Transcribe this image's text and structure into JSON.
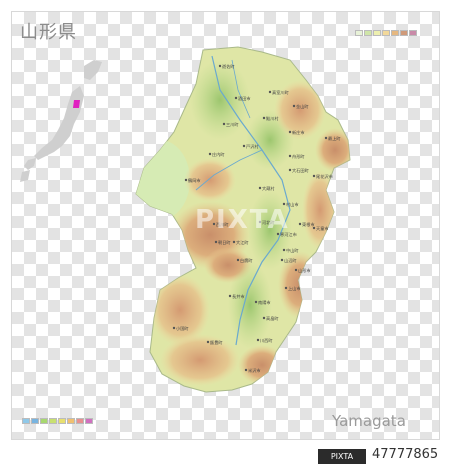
{
  "map": {
    "title_ja": "山形県",
    "title_en": "Yamagata",
    "watermark": "PIXTA",
    "legend_colors_top": [
      "#e8f2d8",
      "#cfe5a8",
      "#eef0b0",
      "#f2d89a",
      "#e6b880",
      "#cf9a7a",
      "#c98aa8"
    ],
    "legend_colors_bottom": [
      "#8fc8e8",
      "#78b4e0",
      "#a8d870",
      "#c8e070",
      "#e8e070",
      "#f0c070",
      "#e89090",
      "#d070c0"
    ],
    "highlight_color": "#e020c0"
  },
  "footer": {
    "logo": "PIXTA",
    "image_id": "47777865"
  },
  "places": [
    {
      "label": "遊佐町"
    },
    {
      "label": "酒田市"
    },
    {
      "label": "真室川町"
    },
    {
      "label": "金山町"
    },
    {
      "label": "三川町"
    },
    {
      "label": "鮭川村"
    },
    {
      "label": "新庄市"
    },
    {
      "label": "戸沢村"
    },
    {
      "label": "最上町"
    },
    {
      "label": "庄内町"
    },
    {
      "label": "舟形町"
    },
    {
      "label": "鶴岡市"
    },
    {
      "label": "大石田町"
    },
    {
      "label": "尾花沢市"
    },
    {
      "label": "大蔵村"
    },
    {
      "label": "村山市"
    },
    {
      "label": "西川町"
    },
    {
      "label": "河北町"
    },
    {
      "label": "東根市"
    },
    {
      "label": "朝日町"
    },
    {
      "label": "大江町"
    },
    {
      "label": "寒河江市"
    },
    {
      "label": "天童市"
    },
    {
      "label": "中山町"
    },
    {
      "label": "山辺町"
    },
    {
      "label": "山形市"
    },
    {
      "label": "白鷹町"
    },
    {
      "label": "上山市"
    },
    {
      "label": "長井市"
    },
    {
      "label": "南陽市"
    },
    {
      "label": "小国町"
    },
    {
      "label": "高畠町"
    },
    {
      "label": "川西町"
    },
    {
      "label": "飯豊町"
    },
    {
      "label": "米沢市"
    }
  ]
}
